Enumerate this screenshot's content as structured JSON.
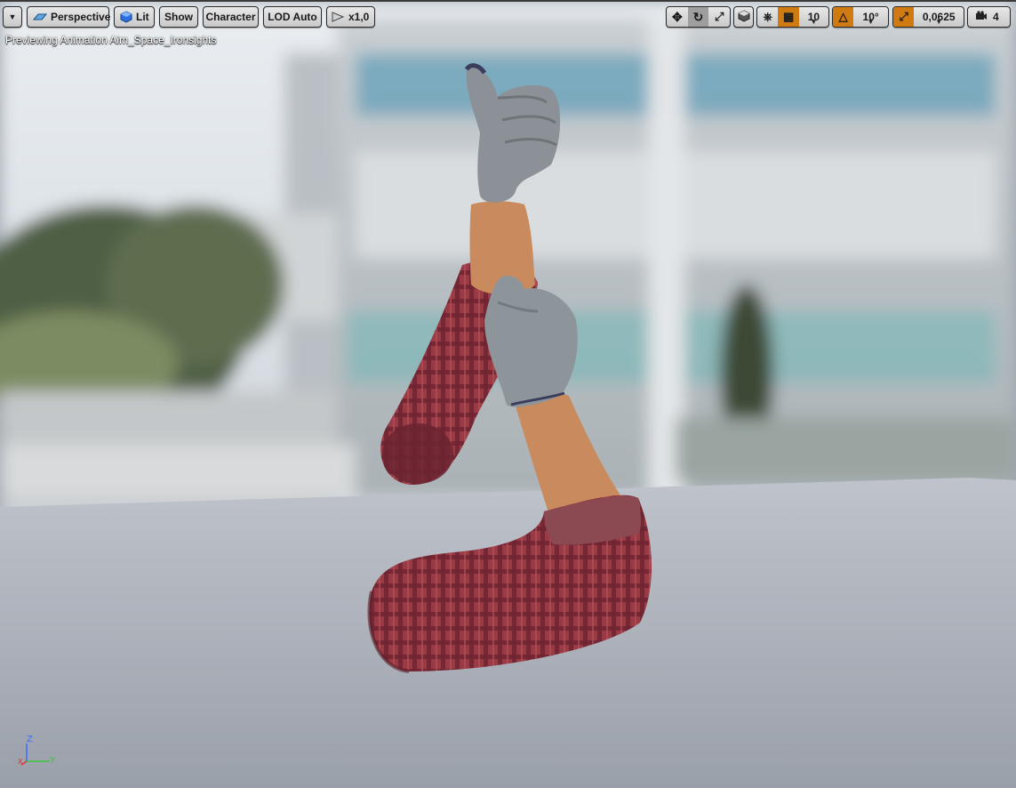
{
  "toolbar": {
    "menu_icon": "chevron-down-icon",
    "perspective_label": "Perspective",
    "lit_label": "Lit",
    "show_label": "Show",
    "character_label": "Character",
    "lod_label": "LOD Auto",
    "speed_label": "x1,0",
    "grid_snap_value": "10",
    "rotation_snap_value": "10°",
    "scale_snap_value": "0,0625",
    "camera_speed_value": "4"
  },
  "viewport": {
    "preview_text": "Previewing Animation Aim_Space_Ironsights",
    "axis_labels": {
      "z": "Z",
      "x": "X",
      "y": "Y"
    }
  },
  "colors": {
    "accent_orange": "#d07a12",
    "shirt_red": "#8a2f3a",
    "glove_gray": "#8b9196",
    "skin": "#c98a5e",
    "floor": "#a9aeb8"
  }
}
